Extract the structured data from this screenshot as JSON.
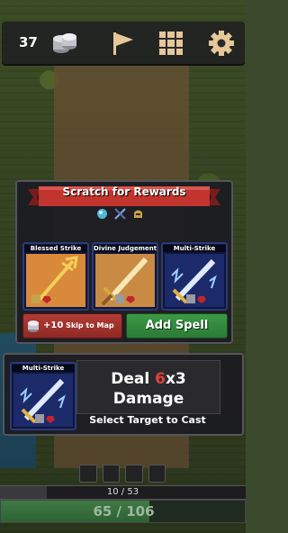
{
  "topbar": {
    "coins": "37",
    "icons": [
      "coins-icon",
      "flag-icon",
      "grid-icon",
      "gear-icon"
    ]
  },
  "rewards": {
    "title": "Scratch for Rewards",
    "cards": [
      {
        "name": "Blessed Strike",
        "art": "golden-trident"
      },
      {
        "name": "Divine Judgement",
        "art": "golden-sword"
      },
      {
        "name": "Multi-Strike",
        "art": "lightning-sword"
      }
    ],
    "skip_amount": "+10",
    "skip_label": "Skip to Map",
    "add_label": "Add Spell"
  },
  "cast": {
    "card_name": "Multi-Strike",
    "deal_word": "Deal",
    "damage_value": "6",
    "multiplier": "x3",
    "damage_word": "Damage",
    "hint": "Select Target to Cast"
  },
  "status": {
    "xp_text": "10 / 53",
    "xp_fraction": 0.19,
    "hp_text": "65 / 106",
    "hp_fraction": 0.61
  },
  "colors": {
    "damage_red": "#e2423b",
    "skip_red": "#b23b35",
    "add_green": "#3b9a45",
    "card_border": "#2b3a7a"
  }
}
